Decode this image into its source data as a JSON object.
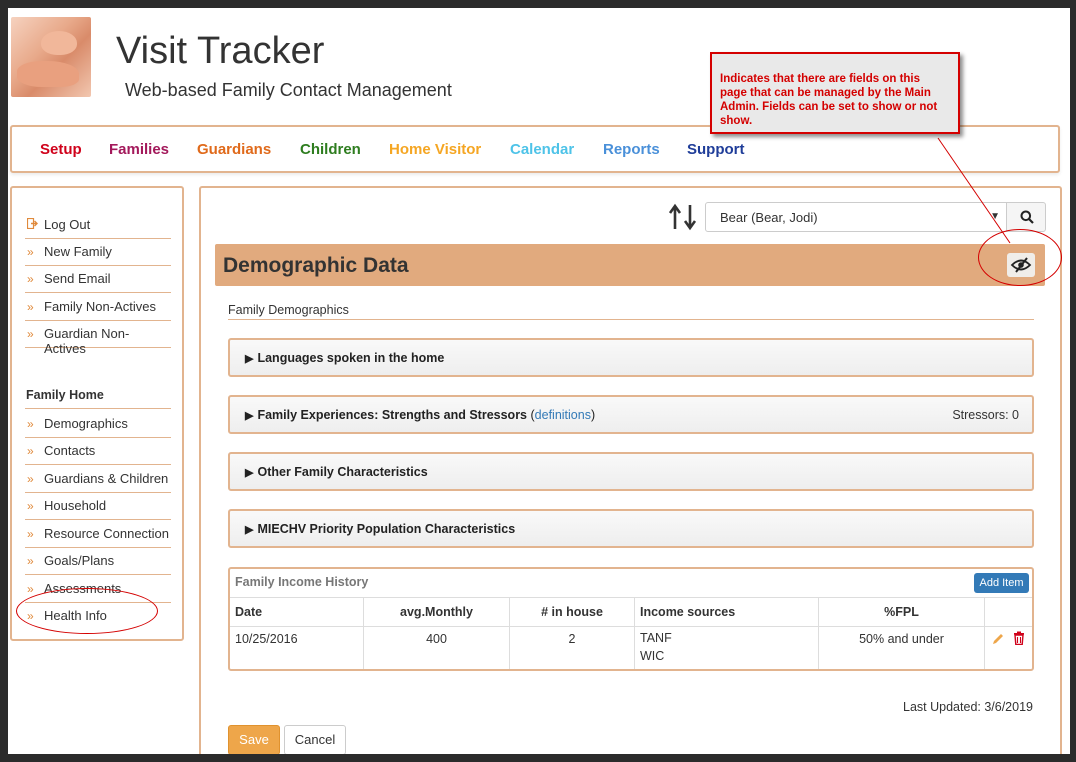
{
  "app": {
    "title": "Visit Tracker",
    "subtitle": "Web-based Family Contact Management"
  },
  "callout": {
    "text": "Indicates that there are fields on this page that can be managed by the Main Admin. Fields can be set to show or not show.",
    "color": "#d40000"
  },
  "nav": {
    "items": [
      {
        "label": "Setup",
        "color": "#d0021b"
      },
      {
        "label": "Families",
        "color": "#a3195b"
      },
      {
        "label": "Guardians",
        "color": "#e06a1b"
      },
      {
        "label": "Children",
        "color": "#2e7d1f"
      },
      {
        "label": "Home Visitor",
        "color": "#f5a623"
      },
      {
        "label": "Calendar",
        "color": "#4ec3e8"
      },
      {
        "label": "Reports",
        "color": "#4a90d9"
      },
      {
        "label": "Support",
        "color": "#1f3d99"
      }
    ]
  },
  "sidebar": {
    "top_items": [
      {
        "label": "Log Out",
        "icon": "logout-icon"
      },
      {
        "label": "New Family",
        "icon": "chevron-double-right-icon"
      },
      {
        "label": "Send Email",
        "icon": "chevron-double-right-icon"
      },
      {
        "label": "Family Non-Actives",
        "icon": "chevron-double-right-icon"
      },
      {
        "label": "Guardian Non-Actives",
        "icon": "chevron-double-right-icon"
      }
    ],
    "heading": "Family Home",
    "home_items": [
      {
        "label": "Demographics"
      },
      {
        "label": "Contacts"
      },
      {
        "label": "Guardians & Children"
      },
      {
        "label": "Household"
      },
      {
        "label": "Resource Connection"
      },
      {
        "label": "Goals/Plans"
      },
      {
        "label": "Assessments"
      },
      {
        "label": "Health Info"
      }
    ]
  },
  "main": {
    "family_select": {
      "value": "Bear (Bear, Jodi)"
    },
    "section_title": "Demographic Data",
    "subsection_label": "Family Demographics",
    "panels": [
      {
        "title": "Languages spoken in the home",
        "link": "",
        "right": ""
      },
      {
        "title": "Family Experiences: Strengths and Stressors",
        "link": "definitions",
        "right": "Stressors: 0"
      },
      {
        "title": "Other Family Characteristics",
        "link": "",
        "right": ""
      },
      {
        "title": "MIECHV Priority Population Characteristics",
        "link": "",
        "right": ""
      }
    ],
    "income": {
      "title": "Family Income History",
      "add_label": "Add Item",
      "columns": [
        "Date",
        "avg.Monthly",
        "# in house",
        "Income sources",
        "%FPL"
      ],
      "rows": [
        {
          "date": "10/25/2016",
          "avg_monthly": "400",
          "in_house": "2",
          "sources": [
            "TANF",
            "WIC"
          ],
          "fpl": "50% and under"
        }
      ]
    },
    "last_updated": "Last Updated: 3/6/2019",
    "save_label": "Save",
    "cancel_label": "Cancel"
  }
}
